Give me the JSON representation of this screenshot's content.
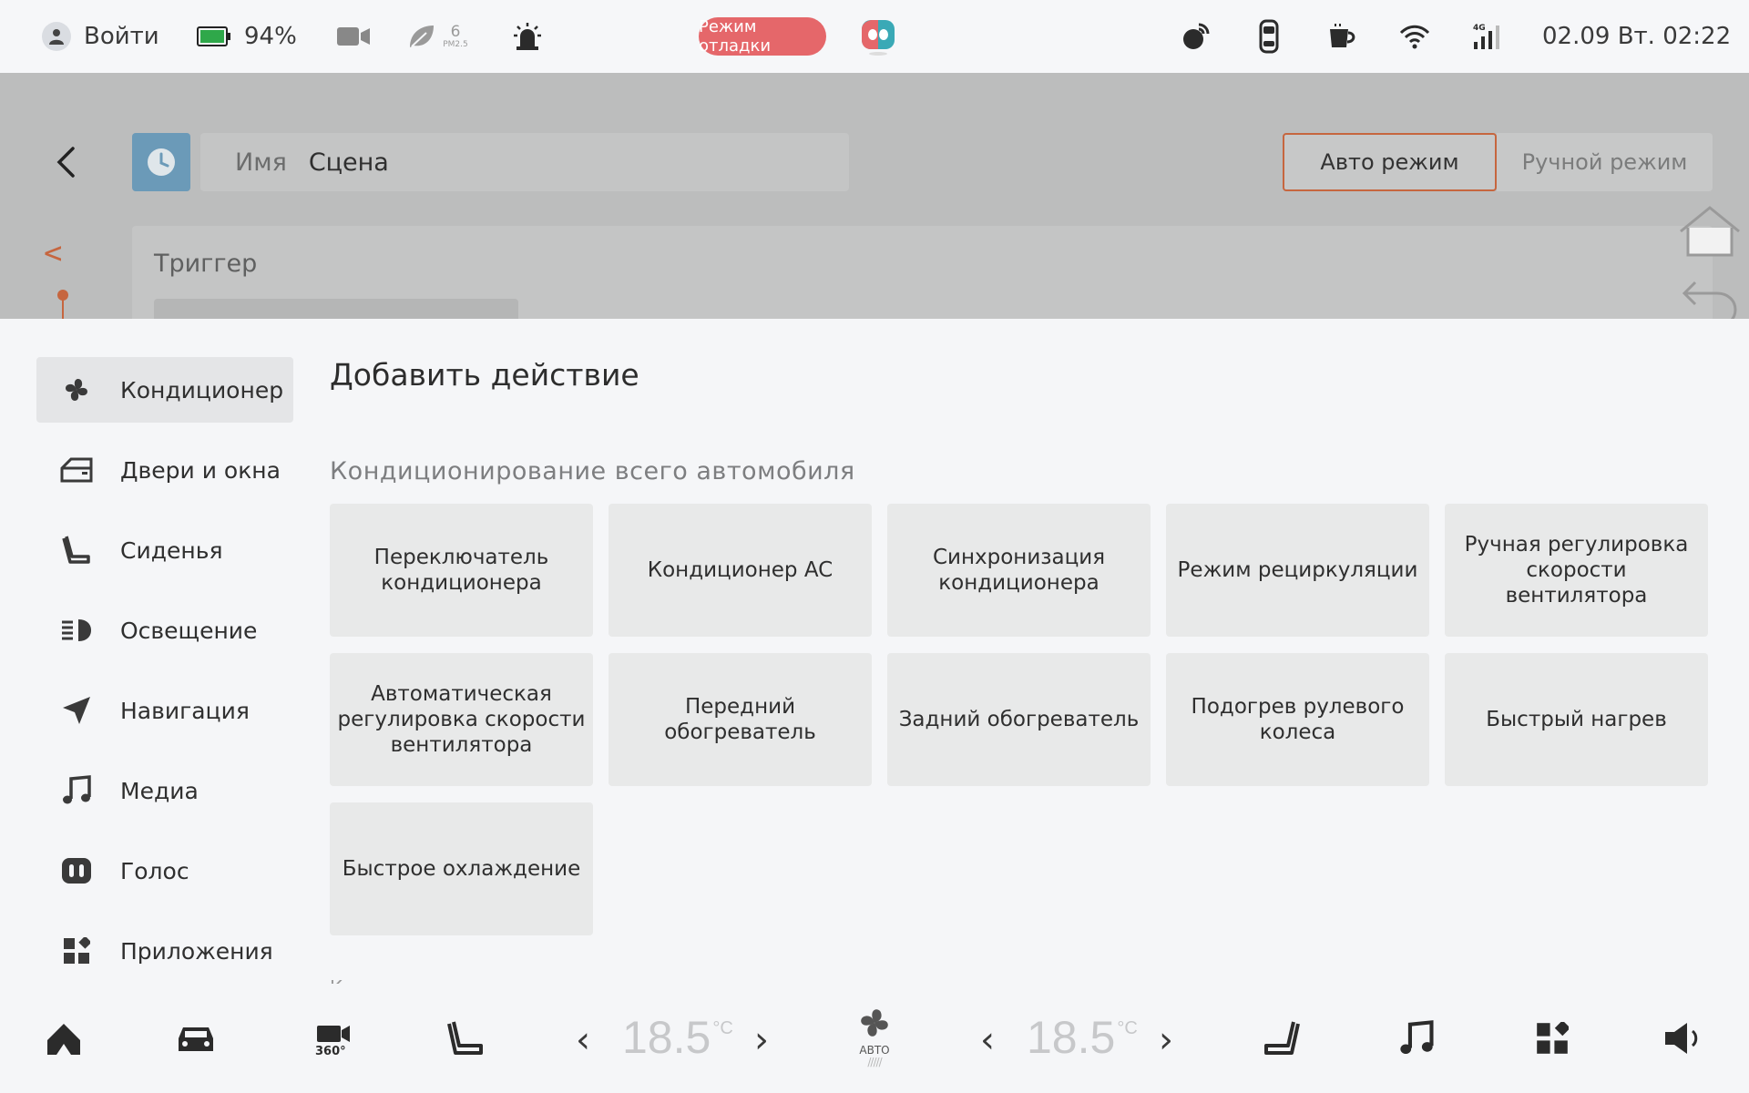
{
  "status_bar": {
    "login_label": "Войти",
    "battery_percent": "94%",
    "pm_value": "6",
    "pm_label": "PM2.5",
    "debug_mode_label": "Режим отладки",
    "datetime": "02.09 Вт. 02:22",
    "network_label": "4G"
  },
  "scene_editor": {
    "name_label": "Имя",
    "name_value": "Сцена",
    "auto_mode_label": "Авто режим",
    "manual_mode_label": "Ручной режим",
    "trigger_label": "Триггер",
    "collapse_symbol": "<"
  },
  "sidebar": {
    "items": [
      {
        "label": "Кондиционер",
        "icon": "fan-icon",
        "active": true
      },
      {
        "label": "Двери и окна",
        "icon": "door-icon",
        "active": false
      },
      {
        "label": "Сиденья",
        "icon": "seat-icon",
        "active": false
      },
      {
        "label": "Освещение",
        "icon": "headlight-icon",
        "active": false
      },
      {
        "label": "Навигация",
        "icon": "navigation-icon",
        "active": false
      },
      {
        "label": "Медиа",
        "icon": "music-icon",
        "active": false
      },
      {
        "label": "Голос",
        "icon": "voice-icon",
        "active": false
      },
      {
        "label": "Приложения",
        "icon": "apps-icon",
        "active": false
      }
    ]
  },
  "panel": {
    "title": "Добавить действие",
    "section_title": "Кондиционирование всего автомобиля",
    "next_section_peek": "К",
    "actions": [
      "Переключатель кондиционера",
      "Кондиционер AC",
      "Синхронизация кондиционера",
      "Режим рециркуляции",
      "Ручная регулировка скорости вентилятора",
      "Автоматическая регулировка скорости вентилятора",
      "Передний обогреватель",
      "Задний обогреватель",
      "Подогрев рулевого колеса",
      "Быстрый нагрев",
      "Быстрое охлаждение"
    ]
  },
  "dock": {
    "left_temp": "18.5",
    "right_temp": "18.5",
    "temp_unit": "°C",
    "fan_mode_label": "АВТО",
    "left_chev": "‹",
    "right_chev": "›"
  },
  "colors": {
    "accent": "#c6663f",
    "debug_pill": "#e5676a",
    "battery": "#2fa84a"
  }
}
